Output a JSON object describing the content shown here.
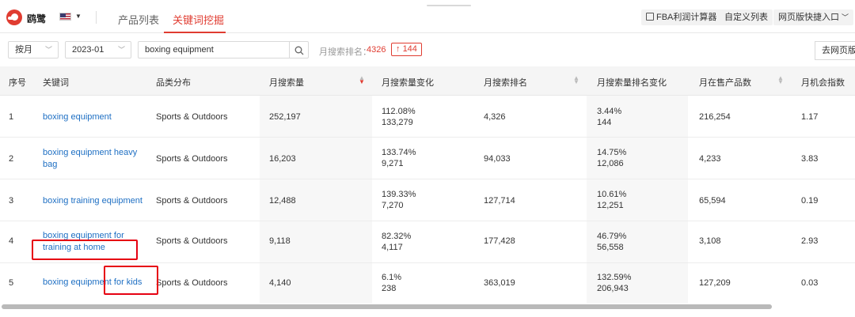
{
  "header": {
    "brand": "鸥鹭",
    "tabs": [
      "产品列表",
      "关键词挖掘"
    ],
    "active_tab": 1,
    "buttons": {
      "fba": "FBA利润计算器",
      "custom": "自定义列表",
      "quick": "网页版快捷入口"
    }
  },
  "filters": {
    "period": "按月",
    "month": "2023-01",
    "search_value": "boxing equipment",
    "rank_label": "月搜索排名：",
    "rank_value": "4326",
    "rank_change": "144",
    "goto_web": "去网页版"
  },
  "table": {
    "columns": [
      "序号",
      "关键词",
      "品类分布",
      "月搜索量",
      "月搜索量变化",
      "月搜索排名",
      "月搜索量排名变化",
      "月在售产品数",
      "月机会指数"
    ],
    "rows": [
      {
        "no": "1",
        "keyword": "boxing equipment",
        "category": "Sports & Outdoors",
        "volume": "252,197",
        "vol_change_pct": "112.08%",
        "vol_change_abs": "133,279",
        "rank": "4,326",
        "rank_change_pct": "3.44%",
        "rank_change_abs": "144",
        "products": "216,254",
        "opportunity": "1.17"
      },
      {
        "no": "2",
        "keyword": "boxing equipment heavy bag",
        "category": "Sports & Outdoors",
        "volume": "16,203",
        "vol_change_pct": "133.74%",
        "vol_change_abs": "9,271",
        "rank": "94,033",
        "rank_change_pct": "14.75%",
        "rank_change_abs": "12,086",
        "products": "4,233",
        "opportunity": "3.83"
      },
      {
        "no": "3",
        "keyword": "boxing training equipment",
        "category": "Sports & Outdoors",
        "volume": "12,488",
        "vol_change_pct": "139.33%",
        "vol_change_abs": "7,270",
        "rank": "127,714",
        "rank_change_pct": "10.61%",
        "rank_change_abs": "12,251",
        "products": "65,594",
        "opportunity": "0.19"
      },
      {
        "no": "4",
        "keyword": "boxing equipment for training at home",
        "category": "Sports & Outdoors",
        "volume": "9,118",
        "vol_change_pct": "82.32%",
        "vol_change_abs": "4,117",
        "rank": "177,428",
        "rank_change_pct": "46.79%",
        "rank_change_abs": "56,558",
        "products": "3,108",
        "opportunity": "2.93"
      },
      {
        "no": "5",
        "keyword": "boxing equipment for kids",
        "category": "Sports & Outdoors",
        "volume": "4,140",
        "vol_change_pct": "6.1%",
        "vol_change_abs": "238",
        "rank": "363,019",
        "rank_change_pct": "132.59%",
        "rank_change_abs": "206,943",
        "products": "127,209",
        "opportunity": "0.03"
      }
    ]
  },
  "colors": {
    "accent": "#e03c31",
    "link": "#1e6fc3",
    "highlight_box": "#e60012"
  }
}
